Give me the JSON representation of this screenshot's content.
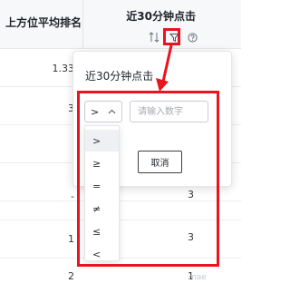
{
  "table": {
    "columns": [
      {
        "title": "上方位平均排名"
      },
      {
        "title": "近30分钟点击"
      }
    ],
    "rows": [
      {
        "left": "1.33",
        "right": ""
      },
      {
        "left": "3",
        "right": ""
      },
      {
        "left": "",
        "right": ""
      },
      {
        "left": "",
        "right": ""
      },
      {
        "left": "-",
        "right": "3"
      },
      {
        "left": "1",
        "right": "3"
      },
      {
        "left": "2",
        "right": "1"
      }
    ]
  },
  "filter_popover": {
    "title": "近30分钟点击",
    "operator": {
      "selected": ">",
      "options": [
        ">",
        "≥",
        "=",
        "≠",
        "≤",
        "<"
      ]
    },
    "value_input": {
      "value": "",
      "placeholder": "请输入数字"
    },
    "cancel_label": "取消"
  },
  "watermark": "mae",
  "colors": {
    "annotation_red": "#e8141e",
    "header_bg": "#f7f8fa",
    "selected_option_bg": "#eef0f3"
  },
  "icons": {
    "sort": "sort-icon",
    "filter": "filter-icon",
    "help": "help-circle-icon",
    "chevron": "chevron-up-icon"
  }
}
